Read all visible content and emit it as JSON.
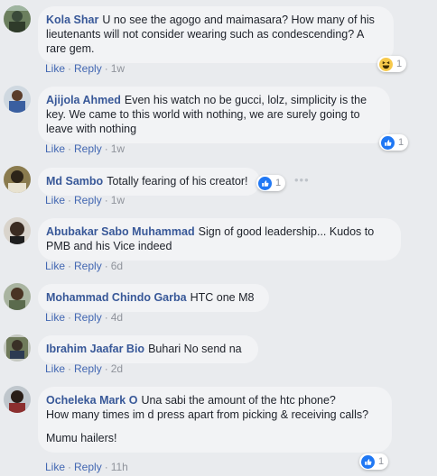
{
  "comments": [
    {
      "author": "Kola Shar",
      "paragraphs": [
        "U no see the agogo and maimasara? How many of his lieutenants will not consider wearing such as condescending? A rare gem."
      ],
      "like": "Like",
      "reply": "Reply",
      "time": "1w",
      "reaction": {
        "icon": "haha-icon",
        "count": "1"
      }
    },
    {
      "author": "Ajijola Ahmed",
      "paragraphs": [
        "Even his watch no be gucci, lolz, simplicity is the key. We came to this world with nothing, we are surely going to leave with nothing"
      ],
      "like": "Like",
      "reply": "Reply",
      "time": "1w",
      "reaction": {
        "icon": "like-icon",
        "count": "1"
      }
    },
    {
      "author": "Md Sambo",
      "paragraphs": [
        "Totally fearing of his creator!"
      ],
      "like": "Like",
      "reply": "Reply",
      "time": "1w",
      "reaction": {
        "icon": "like-icon",
        "count": "1"
      },
      "more": "•••"
    },
    {
      "author": "Abubakar Sabo Muhammad",
      "paragraphs": [
        "Sign of good leadership... Kudos to PMB and his Vice indeed"
      ],
      "like": "Like",
      "reply": "Reply",
      "time": "6d"
    },
    {
      "author": "Mohammad Chindo Garba",
      "paragraphs": [
        "HTC one M8"
      ],
      "like": "Like",
      "reply": "Reply",
      "time": "4d"
    },
    {
      "author": "Ibrahim Jaafar Bio",
      "paragraphs": [
        "Buhari No send na"
      ],
      "like": "Like",
      "reply": "Reply",
      "time": "2d"
    },
    {
      "author": "Ocheleka Mark O",
      "paragraphs": [
        "Una sabi the amount of the htc phone?",
        "How many times im d press apart from picking & receiving calls?",
        "Mumu hailers!"
      ],
      "like": "Like",
      "reply": "Reply",
      "time": "11h",
      "reaction": {
        "icon": "like-icon",
        "count": "1"
      }
    }
  ],
  "colors": {
    "background": "#e9ebee",
    "bubble": "#f2f3f5",
    "author": "#385898",
    "action_link": "#4267b2",
    "like_blue": "#2078f4",
    "haha_yellow": "#f7c94b"
  }
}
